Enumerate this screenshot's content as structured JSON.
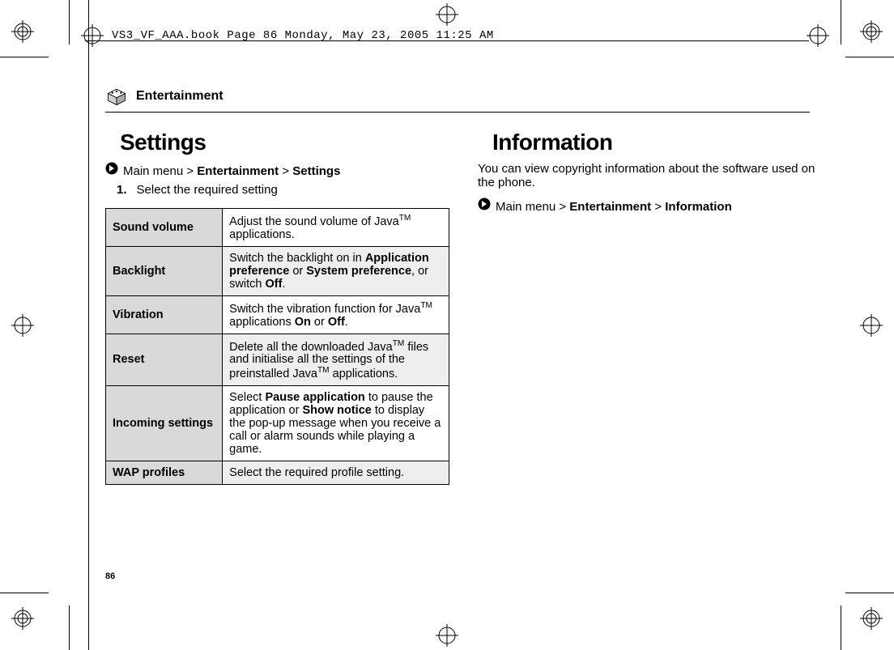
{
  "meta": {
    "header_text": "VS3_VF_AAA.book  Page 86  Monday, May 23, 2005  11:25 AM",
    "page_number": "86",
    "section": "Entertainment"
  },
  "left": {
    "heading": "Settings",
    "breadcrumb": {
      "pre": "Main menu > ",
      "bold1": "Entertainment",
      "sep": " > ",
      "bold2": "Settings"
    },
    "step_num": "1.",
    "step_text": "Select the required setting",
    "rows": [
      {
        "key": "Sound volume",
        "html": "Adjust the sound volume of Java<sup>TM</sup> applications."
      },
      {
        "key": "Backlight",
        "html": "Switch the backlight on in <span class='b'>Application preference</span> or <span class='b'>System preference</span>, or switch <span class='b'>Off</span>."
      },
      {
        "key": "Vibration",
        "html": "Switch the vibration function for Java<sup>TM</sup> applications <span class='b'>On</span> or <span class='b'>Off</span>."
      },
      {
        "key": "Reset",
        "html": "Delete all the downloaded Java<sup>TM</sup> files and initialise all the settings of the preinstalled Java<sup>TM</sup> applications."
      },
      {
        "key": "Incoming settings",
        "html": "Select <span class='b'>Pause application</span> to pause the application or <span class='b'>Show notice</span> to display the pop-up message when you receive a call or alarm sounds while playing a game."
      },
      {
        "key": "WAP profiles",
        "html": "Select the required profile setting."
      }
    ]
  },
  "right": {
    "heading": "Information",
    "intro": "You can view copyright information about the software used on the phone.",
    "breadcrumb": {
      "pre": "Main menu > ",
      "bold1": "Entertainment",
      "sep": " > ",
      "bold2": "Information"
    }
  }
}
